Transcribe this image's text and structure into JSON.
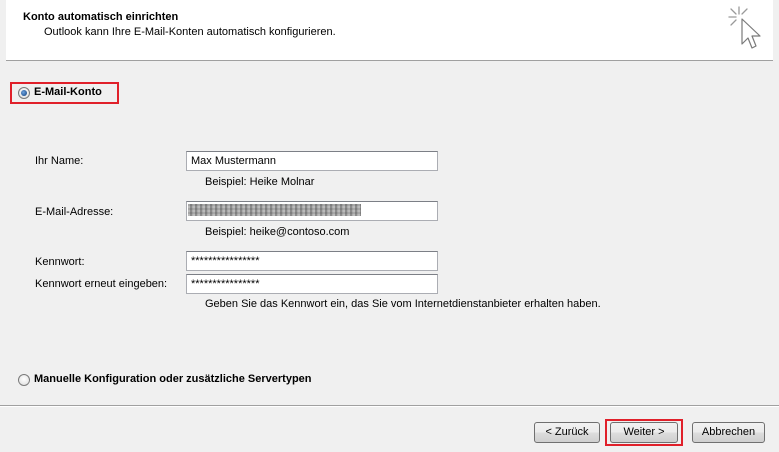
{
  "header": {
    "title": "Konto automatisch einrichten",
    "subtitle": "Outlook kann Ihre E-Mail-Konten automatisch konfigurieren.",
    "icon": "cursor-sparkle-icon"
  },
  "email_option": {
    "label": "E-Mail-Konto",
    "selected": true
  },
  "form": {
    "name_label": "Ihr Name:",
    "name_value": "Max Mustermann",
    "name_hint": "Beispiel: Heike Molnar",
    "email_label": "E-Mail-Adresse:",
    "email_hint": "Beispiel: heike@contoso.com",
    "password_label": "Kennwort:",
    "password_value": "****************",
    "password_repeat_label": "Kennwort erneut eingeben:",
    "password_repeat_value": "****************",
    "password_hint": "Geben Sie das Kennwort ein, das Sie vom Internetdienstanbieter erhalten haben."
  },
  "manual_option": {
    "label": "Manuelle Konfiguration oder zusätzliche Servertypen",
    "selected": false
  },
  "buttons": {
    "back": "< Zurück",
    "next": "Weiter >",
    "cancel": "Abbrechen"
  },
  "colors": {
    "highlight": "#e0202a",
    "header_bg": "#ffffff",
    "body_bg": "#f0f0f0"
  }
}
